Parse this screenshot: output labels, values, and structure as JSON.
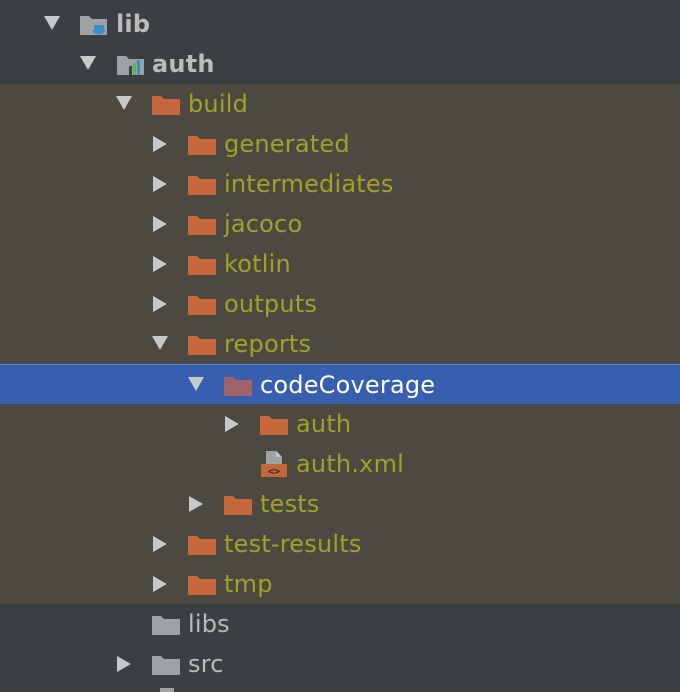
{
  "colors": {
    "panel_bg": "#3c3f41",
    "excluded_bg": "#4b4940",
    "selection_bg": "#375fad",
    "excluded_text": "#a3a128",
    "normal_text": "#bbbbbb",
    "selected_text": "#ffffff",
    "folder_orange": "#c5673a",
    "folder_gray": "#9da2a6"
  },
  "tree": {
    "items": [
      {
        "label": "lib",
        "expanded": true,
        "icon": "module-folder-icon",
        "style": "module"
      },
      {
        "label": "auth",
        "expanded": true,
        "icon": "android-module-folder-icon",
        "style": "module"
      },
      {
        "label": "build",
        "expanded": true,
        "icon": "excluded-folder-icon",
        "style": "excluded"
      },
      {
        "label": "generated",
        "expanded": false,
        "icon": "excluded-folder-icon",
        "style": "excluded"
      },
      {
        "label": "intermediates",
        "expanded": false,
        "icon": "excluded-folder-icon",
        "style": "excluded"
      },
      {
        "label": "jacoco",
        "expanded": false,
        "icon": "excluded-folder-icon",
        "style": "excluded"
      },
      {
        "label": "kotlin",
        "expanded": false,
        "icon": "excluded-folder-icon",
        "style": "excluded"
      },
      {
        "label": "outputs",
        "expanded": false,
        "icon": "excluded-folder-icon",
        "style": "excluded"
      },
      {
        "label": "reports",
        "expanded": true,
        "icon": "excluded-folder-icon",
        "style": "excluded"
      },
      {
        "label": "codeCoverage",
        "expanded": true,
        "icon": "excluded-folder-icon",
        "style": "selected"
      },
      {
        "label": "auth",
        "expanded": false,
        "icon": "excluded-folder-icon",
        "style": "excluded"
      },
      {
        "label": "auth.xml",
        "expanded": null,
        "icon": "xml-file-icon",
        "style": "excluded"
      },
      {
        "label": "tests",
        "expanded": false,
        "icon": "excluded-folder-icon",
        "style": "excluded"
      },
      {
        "label": "test-results",
        "expanded": false,
        "icon": "excluded-folder-icon",
        "style": "excluded"
      },
      {
        "label": "tmp",
        "expanded": false,
        "icon": "excluded-folder-icon",
        "style": "excluded"
      },
      {
        "label": "libs",
        "expanded": null,
        "icon": "folder-icon",
        "style": "normal"
      },
      {
        "label": "src",
        "expanded": false,
        "icon": "folder-icon",
        "style": "normal"
      }
    ]
  }
}
